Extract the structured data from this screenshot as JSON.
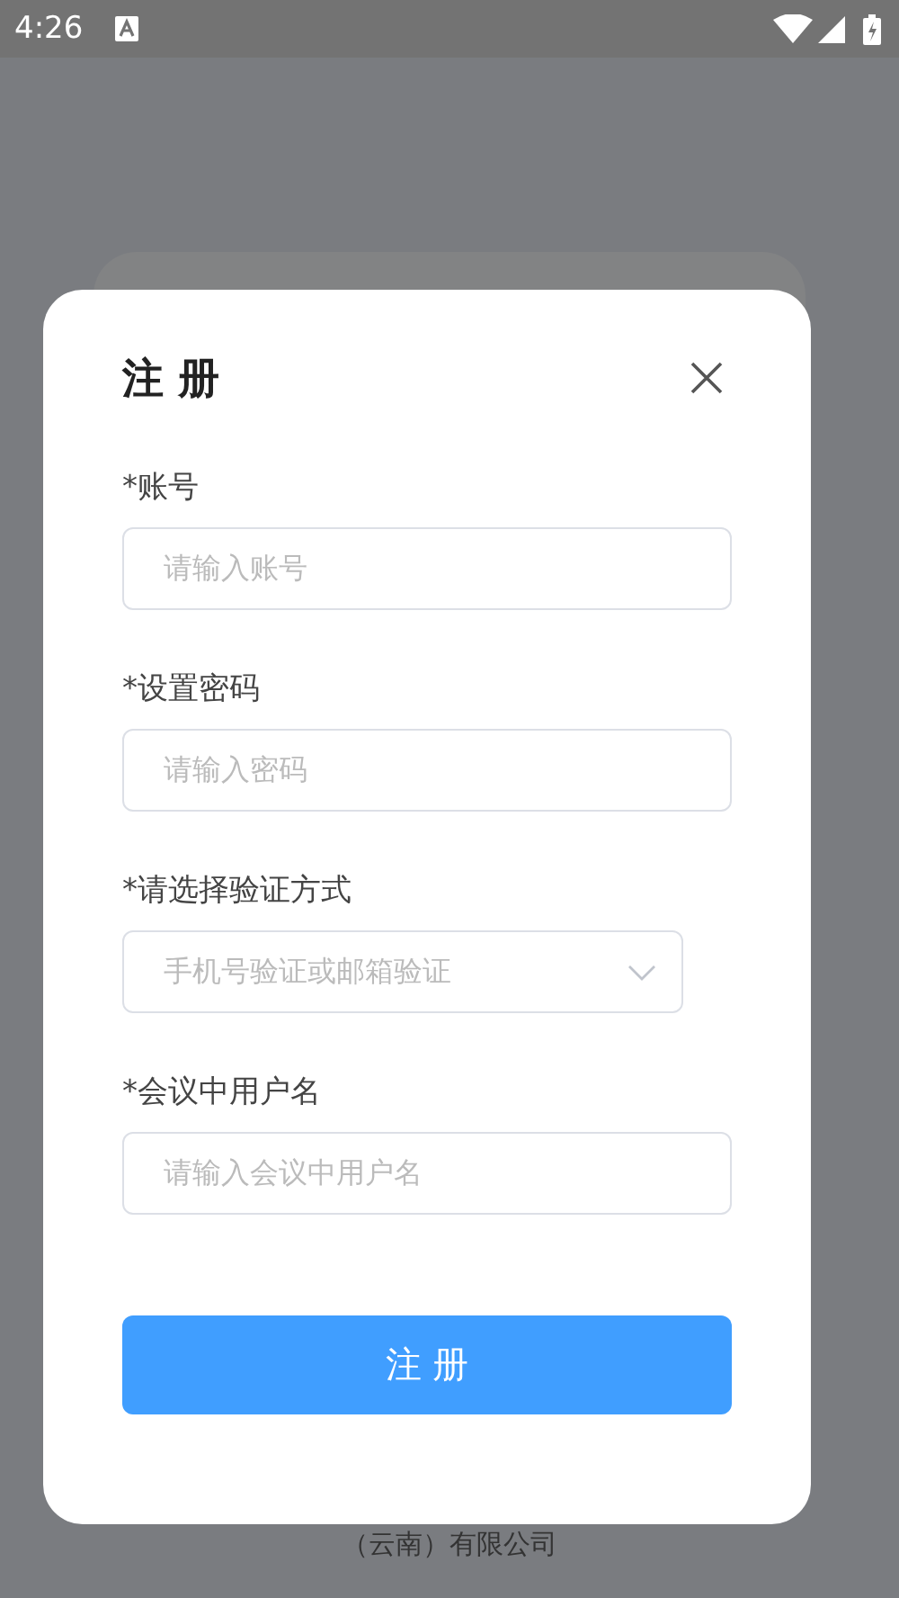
{
  "status_bar": {
    "time": "4:26"
  },
  "dialog": {
    "title": "注 册",
    "fields": [
      {
        "label": "*账号",
        "placeholder": "请输入账号",
        "kind": "input"
      },
      {
        "label": "*设置密码",
        "placeholder": "请输入密码",
        "kind": "input"
      },
      {
        "label": "*请选择验证方式",
        "placeholder": "手机号验证或邮箱验证",
        "kind": "select"
      },
      {
        "label": "*会议中用户名",
        "placeholder": "请输入会议中用户名",
        "kind": "input"
      }
    ],
    "submit_button": "注 册"
  },
  "footer_text": "（云南）有限公司"
}
